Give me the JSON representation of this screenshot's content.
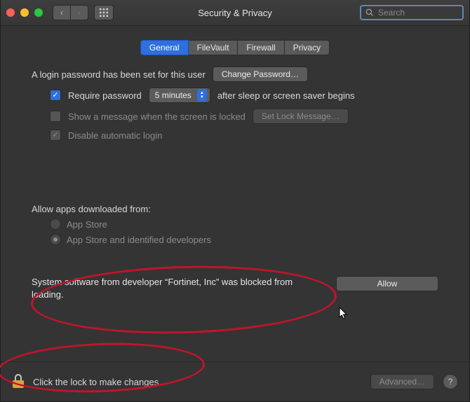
{
  "titlebar": {
    "title": "Security & Privacy",
    "search_placeholder": "Search"
  },
  "tabs": [
    {
      "label": "General",
      "active": true
    },
    {
      "label": "FileVault",
      "active": false
    },
    {
      "label": "Firewall",
      "active": false
    },
    {
      "label": "Privacy",
      "active": false
    }
  ],
  "login": {
    "status_text": "A login password has been set for this user",
    "change_password_label": "Change Password…",
    "require_password_label": "Require password",
    "require_password_checked": true,
    "delay_selected": "5 minutes",
    "after_sleep_text": "after sleep or screen saver begins",
    "show_message_label": "Show a message when the screen is locked",
    "show_message_checked": false,
    "set_lock_message_label": "Set Lock Message…",
    "disable_auto_login_label": "Disable automatic login",
    "disable_auto_login_checked": true
  },
  "downloads": {
    "heading": "Allow apps downloaded from:",
    "options": [
      {
        "label": "App Store",
        "selected": false
      },
      {
        "label": "App Store and identified developers",
        "selected": true
      }
    ]
  },
  "blocked": {
    "message": "System software from developer “Fortinet, Inc” was blocked from loading.",
    "allow_label": "Allow"
  },
  "footer": {
    "lock_text": "Click the lock to make changes.",
    "advanced_label": "Advanced…"
  }
}
